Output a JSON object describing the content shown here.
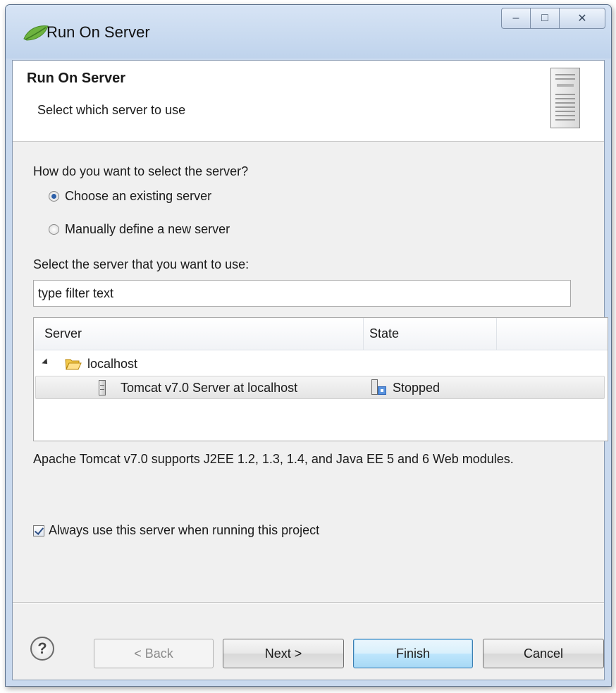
{
  "window": {
    "title": "Run On Server",
    "controls": {
      "minimize": "–",
      "maximize": "□",
      "close": "✕"
    }
  },
  "banner": {
    "title": "Run On Server",
    "subtitle": "Select which server to use"
  },
  "selection": {
    "question": "How do you want to select the server?",
    "options": [
      {
        "label": "Choose an existing server",
        "checked": true
      },
      {
        "label": "Manually define a new server",
        "checked": false
      }
    ],
    "select_label": "Select the server that you want to use:"
  },
  "filter": {
    "value": "type filter text"
  },
  "server_table": {
    "columns": [
      "Server",
      "State"
    ],
    "group": {
      "label": "localhost",
      "icon": "folder-open-icon"
    },
    "rows": [
      {
        "server": "Tomcat v7.0 Server at localhost",
        "state": "Stopped",
        "selected": true
      }
    ]
  },
  "description": "Apache Tomcat v7.0 supports J2EE 1.2, 1.3, 1.4, and Java EE 5 and 6 Web modules.",
  "always_use": {
    "label": "Always use this server when running this project",
    "checked": true
  },
  "buttons": {
    "help": "?",
    "back": "< Back",
    "next": "Next >",
    "finish": "Finish",
    "cancel": "Cancel"
  },
  "colors": {
    "title_bar": "#c9d9ee",
    "dialog_bg": "#f0f0f0",
    "default_button": "#bee6fd"
  }
}
